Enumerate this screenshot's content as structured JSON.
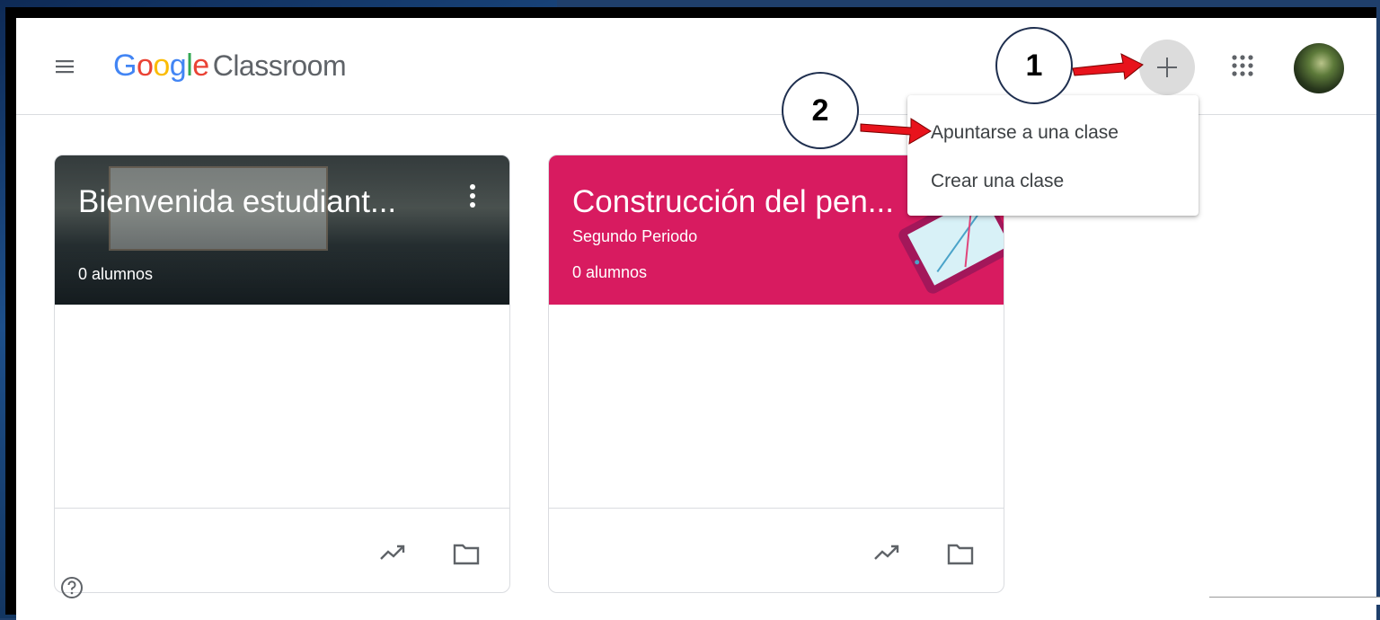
{
  "header": {
    "logo_google": [
      "G",
      "o",
      "o",
      "g",
      "l",
      "e"
    ],
    "logo_product": "Classroom"
  },
  "annotations": {
    "step1": "1",
    "step2": "2"
  },
  "dropdown": {
    "items": [
      {
        "label": "Apuntarse a una clase"
      },
      {
        "label": "Crear una clase"
      }
    ]
  },
  "classes": [
    {
      "title": "Bienvenida estudiant...",
      "subtitle": "",
      "students": "0 alumnos",
      "theme_color": "#3b4a4e"
    },
    {
      "title": "Construcción del pen...",
      "subtitle": "Segundo Periodo",
      "students": "0 alumnos",
      "theme_color": "#d81b60"
    }
  ],
  "icons": {
    "menu": "hamburger-menu-icon",
    "create": "plus-icon",
    "apps": "apps-grid-icon",
    "stream": "trending-up-icon",
    "folder": "folder-icon",
    "help": "help-icon",
    "more": "more-vert-icon"
  },
  "colors": {
    "google_blue": "#4285f4",
    "google_red": "#ea4335",
    "google_yellow": "#fbbc05",
    "google_green": "#34a853",
    "annotation_arrow": "#e8131c"
  }
}
